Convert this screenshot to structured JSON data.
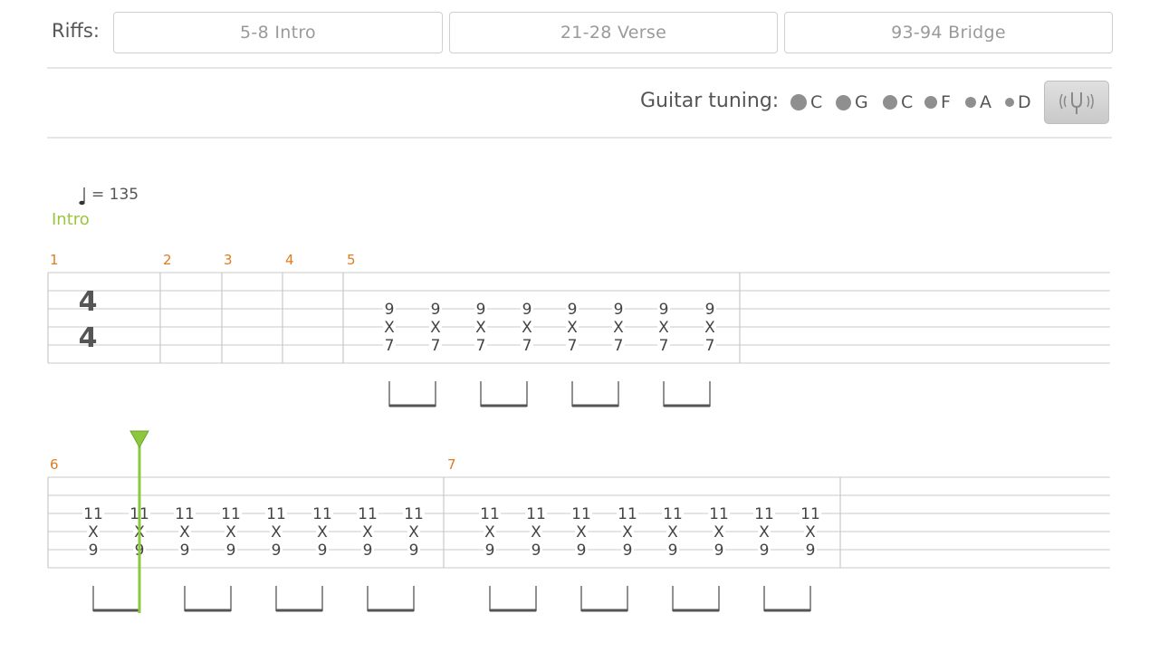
{
  "riffs": {
    "label": "Riffs:",
    "buttons": [
      "5-8 Intro",
      "21-28 Verse",
      "93-94 Bridge"
    ]
  },
  "tuning": {
    "label": "Guitar tuning:",
    "strings": [
      "C",
      "G",
      "C",
      "F",
      "A",
      "D"
    ],
    "tuner_icon": "tuning-fork-icon"
  },
  "score": {
    "tempo": "= 135",
    "section": "Intro",
    "time_signature": {
      "top": "4",
      "bottom": "4"
    },
    "row1_measure_numbers": [
      "1",
      "2",
      "3",
      "4",
      "5"
    ],
    "row2_measure_numbers": [
      "6",
      "7"
    ],
    "row1_chord": [
      "9",
      "X",
      "7"
    ],
    "row2_chord": [
      "11",
      "X",
      "9"
    ],
    "colors": {
      "measure_number": "#e07b20",
      "playhead": "#8dc63f",
      "section": "#9bc53d"
    }
  }
}
